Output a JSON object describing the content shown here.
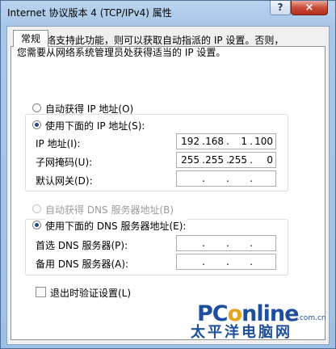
{
  "window": {
    "title": "Internet 协议版本 4 (TCP/IPv4) 属性",
    "help_label": "?",
    "close_label": "×"
  },
  "tab": {
    "label": "常规"
  },
  "description": {
    "line1": "如果网络支持此功能，则可以获取自动指派的 IP 设置。否则，",
    "line2": "您需要从网络系统管理员处获得适当的 IP 设置。"
  },
  "ip_options": {
    "auto_label": "自动获得 IP 地址(O)",
    "manual_label": "使用下面的 IP 地址(S):",
    "selected": "manual"
  },
  "ip_fields": {
    "ip_label": "IP 地址(I):",
    "ip_value": [
      "192",
      "168",
      "1",
      "100"
    ],
    "subnet_label": "子网掩码(U):",
    "subnet_value": [
      "255",
      "255",
      "255",
      "0"
    ],
    "gateway_label": "默认网关(D):",
    "gateway_value": [
      "",
      "",
      "",
      ""
    ]
  },
  "dns_options": {
    "auto_label": "自动获得 DNS 服务器地址(B)",
    "manual_label": "使用下面的 DNS 服务器地址(E):",
    "selected": "manual"
  },
  "dns_fields": {
    "preferred_label": "首选 DNS 服务器(P):",
    "alternate_label": "备用 DNS 服务器(A):"
  },
  "validate": {
    "label": "退出时验证设置(L)",
    "checked": false
  },
  "watermark": {
    "brand_prefix": "PC",
    "brand_o": "o",
    "brand_suffix": "nline",
    "site": ".com.cn",
    "sub": "太平洋电脑网"
  },
  "colors": {
    "accent": "#1c4a86",
    "title_bg": "#b9d3ee",
    "close_red": "#c84532",
    "brand_blue": "#1d4f9c",
    "brand_orange": "#e6a21a"
  }
}
